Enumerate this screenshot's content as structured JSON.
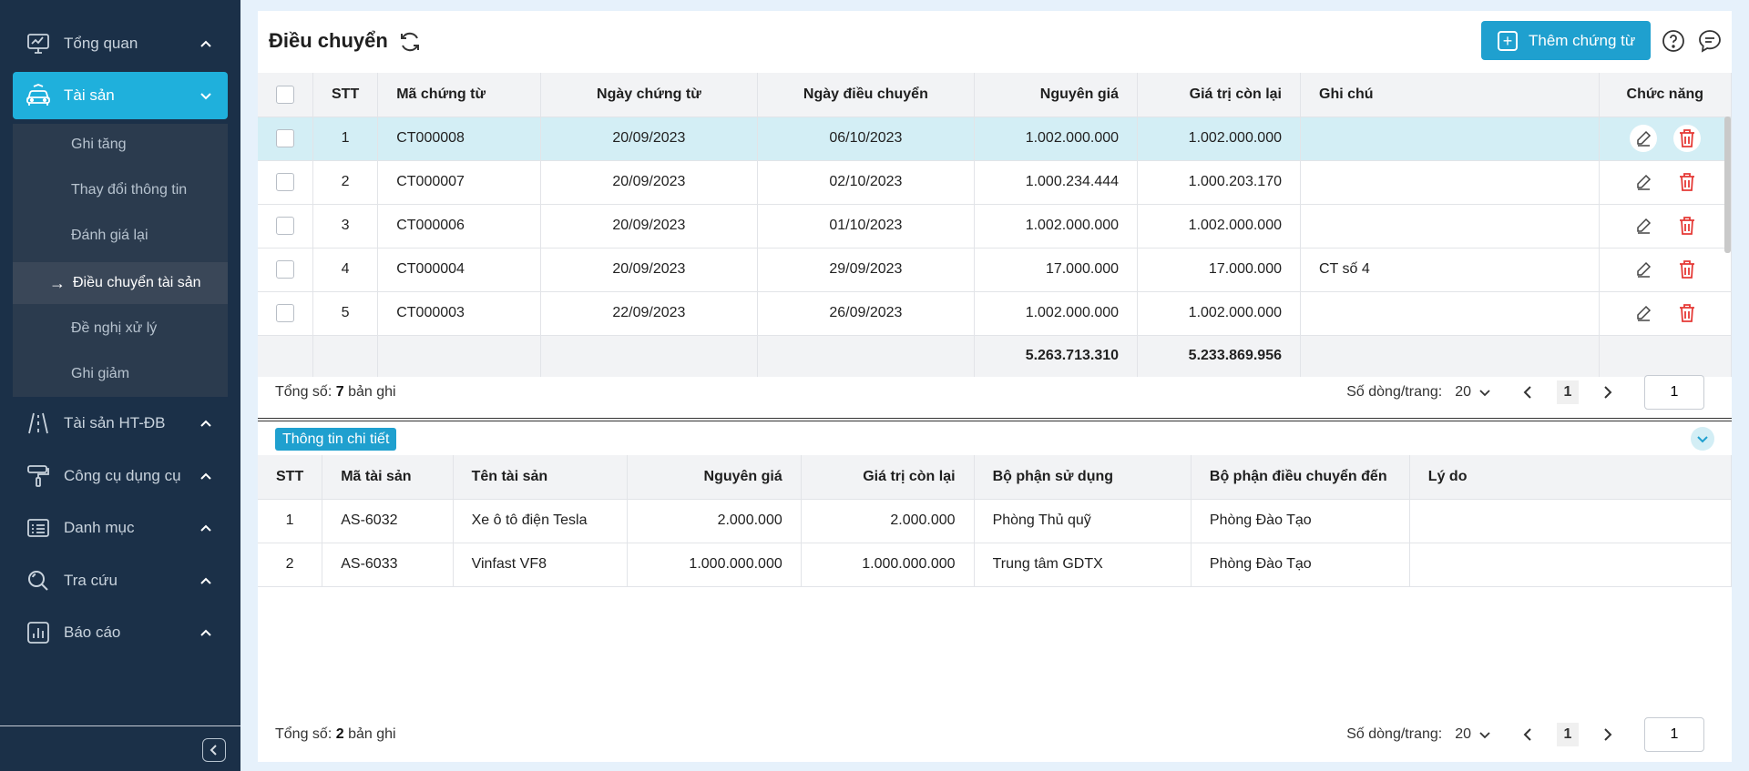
{
  "sidebar": {
    "items": [
      {
        "label": "Tổng quan",
        "icon": "monitor-chart-icon"
      },
      {
        "label": "Tài sản",
        "icon": "car-icon"
      },
      {
        "label": "Tài sản HT-ĐB",
        "icon": "road-icon"
      },
      {
        "label": "Công cụ dụng cụ",
        "icon": "paint-roller-icon"
      },
      {
        "label": "Danh mục",
        "icon": "list-icon"
      },
      {
        "label": "Tra cứu",
        "icon": "search-icon"
      },
      {
        "label": "Báo cáo",
        "icon": "report-chart-icon"
      }
    ],
    "submenu": [
      {
        "label": "Ghi tăng"
      },
      {
        "label": "Thay đổi thông tin"
      },
      {
        "label": "Đánh giá lại"
      },
      {
        "label": "Điều chuyển tài sản"
      },
      {
        "label": "Đề nghị xử lý"
      },
      {
        "label": "Ghi giảm"
      }
    ]
  },
  "header": {
    "title": "Điều chuyển",
    "add_label": "Thêm chứng từ"
  },
  "main_table": {
    "columns": [
      "STT",
      "Mã chứng từ",
      "Ngày chứng từ",
      "Ngày điều chuyển",
      "Nguyên giá",
      "Giá trị còn lại",
      "Ghi chú",
      "Chức năng"
    ],
    "rows": [
      {
        "stt": "1",
        "code": "CT000008",
        "doc_date": "20/09/2023",
        "transfer_date": "06/10/2023",
        "cost": "1.002.000.000",
        "remaining": "1.002.000.000",
        "note": ""
      },
      {
        "stt": "2",
        "code": "CT000007",
        "doc_date": "20/09/2023",
        "transfer_date": "02/10/2023",
        "cost": "1.000.234.444",
        "remaining": "1.000.203.170",
        "note": ""
      },
      {
        "stt": "3",
        "code": "CT000006",
        "doc_date": "20/09/2023",
        "transfer_date": "01/10/2023",
        "cost": "1.002.000.000",
        "remaining": "1.002.000.000",
        "note": ""
      },
      {
        "stt": "4",
        "code": "CT000004",
        "doc_date": "20/09/2023",
        "transfer_date": "29/09/2023",
        "cost": "17.000.000",
        "remaining": "17.000.000",
        "note": "CT số 4"
      },
      {
        "stt": "5",
        "code": "CT000003",
        "doc_date": "22/09/2023",
        "transfer_date": "26/09/2023",
        "cost": "1.002.000.000",
        "remaining": "1.002.000.000",
        "note": ""
      }
    ],
    "totals": {
      "cost": "5.263.713.310",
      "remaining": "5.233.869.956"
    },
    "footer": {
      "total_prefix": "Tổng số:",
      "total_count": "7",
      "total_suffix": "bản ghi",
      "page_size_label": "Số dòng/trang:",
      "page_size": "20",
      "current_page": "1",
      "page_input": "1"
    }
  },
  "detail": {
    "tag": "Thông tin chi tiết",
    "columns": [
      "STT",
      "Mã tài sản",
      "Tên tài sản",
      "Nguyên giá",
      "Giá trị còn lại",
      "Bộ phận sử dụng",
      "Bộ phận điều chuyển đến",
      "Lý do"
    ],
    "rows": [
      {
        "stt": "1",
        "code": "AS-6032",
        "name": "Xe ô tô điện Tesla",
        "cost": "2.000.000",
        "remaining": "2.000.000",
        "dept": "Phòng Thủ quỹ",
        "to_dept": "Phòng Đào Tạo",
        "reason": ""
      },
      {
        "stt": "2",
        "code": "AS-6033",
        "name": "Vinfast VF8",
        "cost": "1.000.000.000",
        "remaining": "1.000.000.000",
        "dept": "Trung tâm GDTX",
        "to_dept": "Phòng Đào Tạo",
        "reason": ""
      }
    ],
    "footer": {
      "total_prefix": "Tổng số:",
      "total_count": "2",
      "total_suffix": "bản ghi",
      "page_size_label": "Số dòng/trang:",
      "page_size": "20",
      "current_page": "1",
      "page_input": "1"
    }
  },
  "colors": {
    "accent": "#1fa0cf",
    "sidebar_bg": "#1b3048",
    "delete": "#e53935",
    "selected_row": "#d3eef5"
  }
}
